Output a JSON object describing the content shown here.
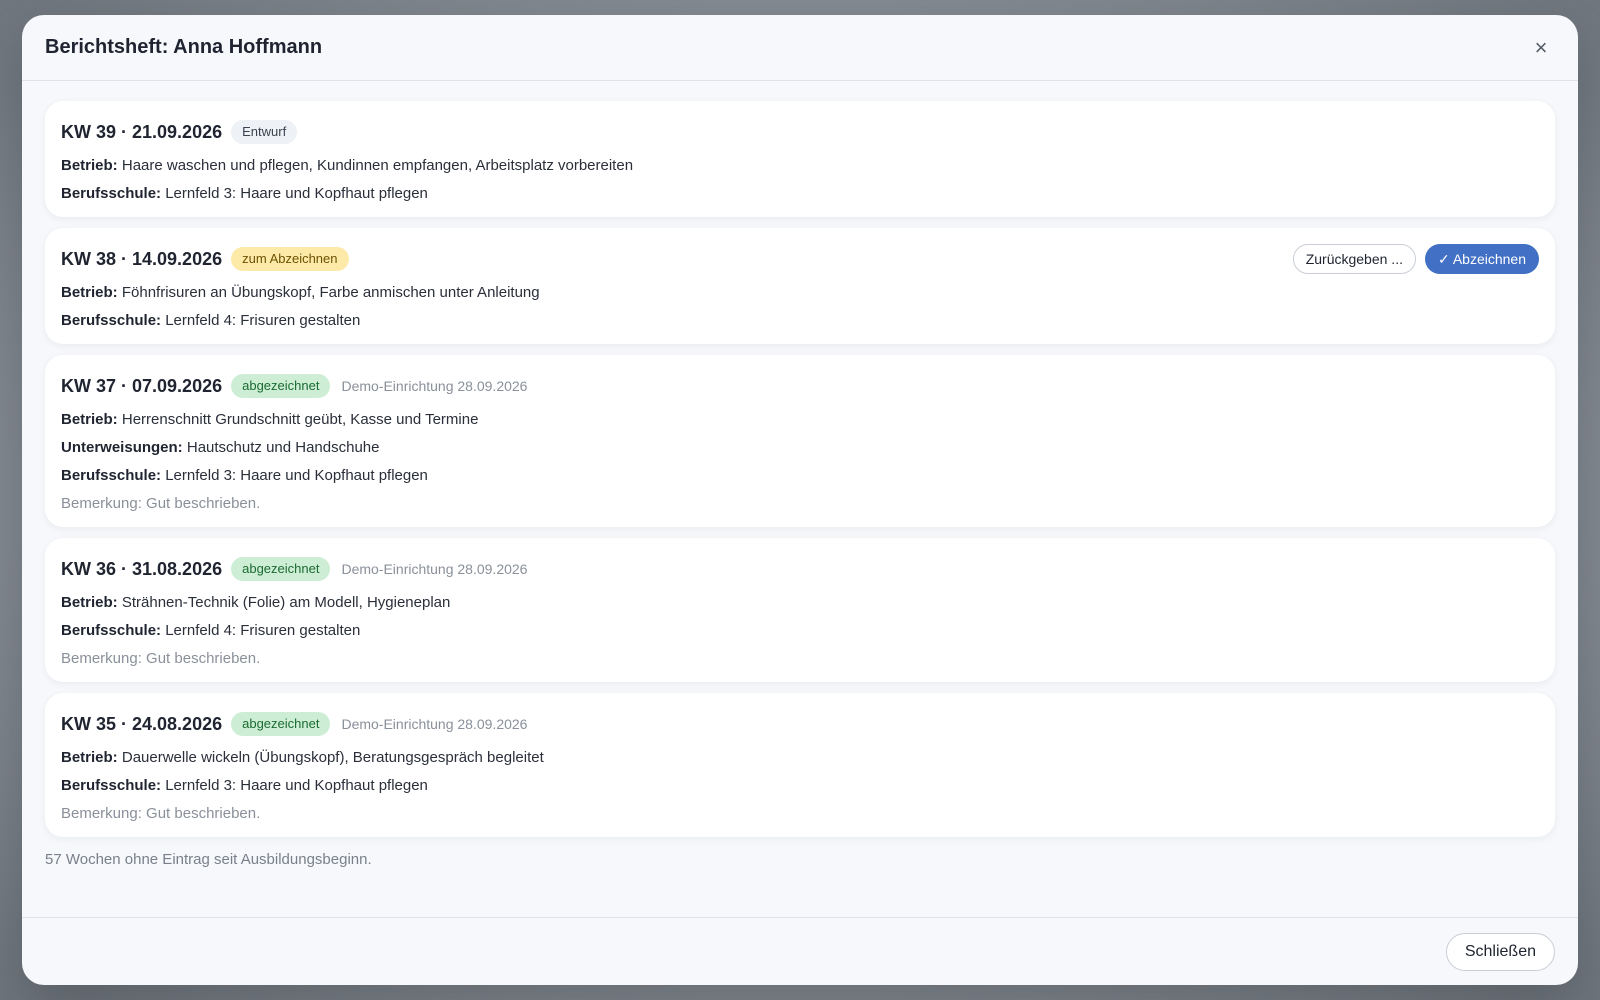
{
  "modal": {
    "title": "Berichtsheft: Anna Hoffmann",
    "close_icon": "×",
    "footer_note": "57 Wochen ohne Eintrag seit Ausbildungsbeginn.",
    "close_button": "Schließen"
  },
  "labels": {
    "betrieb": "Betrieb:",
    "berufsschule": "Berufsschule:",
    "unterweisungen": "Unterweisungen:"
  },
  "entries": [
    {
      "week": "KW 39 · 21.09.2026",
      "status": "Entwurf",
      "betrieb": "Haare waschen und pflegen, Kundinnen empfangen, Arbeitsplatz vorbereiten",
      "berufsschule": "Lernfeld 3: Haare und Kopfhaut pflegen"
    },
    {
      "week": "KW 38 · 14.09.2026",
      "status": "zum Abzeichnen",
      "betrieb": "Föhnfrisuren an Übungskopf, Farbe anmischen unter Anleitung",
      "berufsschule": "Lernfeld 4: Frisuren gestalten",
      "return_button": "Zurückgeben ...",
      "sign_button": "✓ Abzeichnen"
    },
    {
      "week": "KW 37 · 07.09.2026",
      "status": "abgezeichnet",
      "signed_by": "Demo-Einrichtung 28.09.2026",
      "betrieb": "Herrenschnitt Grundschnitt geübt, Kasse und Termine",
      "unterweisungen": "Hautschutz und Handschuhe",
      "berufsschule": "Lernfeld 3: Haare und Kopfhaut pflegen",
      "remark": "Bemerkung: Gut beschrieben."
    },
    {
      "week": "KW 36 · 31.08.2026",
      "status": "abgezeichnet",
      "signed_by": "Demo-Einrichtung 28.09.2026",
      "betrieb": "Strähnen-Technik (Folie) am Modell, Hygieneplan",
      "berufsschule": "Lernfeld 4: Frisuren gestalten",
      "remark": "Bemerkung: Gut beschrieben."
    },
    {
      "week": "KW 35 · 24.08.2026",
      "status": "abgezeichnet",
      "signed_by": "Demo-Einrichtung 28.09.2026",
      "betrieb": "Dauerwelle wickeln (Übungskopf), Beratungsgespräch begleitet",
      "berufsschule": "Lernfeld 3: Haare und Kopfhaut pflegen",
      "remark": "Bemerkung: Gut beschrieben."
    }
  ],
  "colors": {
    "primary": "#4170c4",
    "badge_draft": "#eef1f5",
    "badge_pending": "#fde9a8",
    "badge_signed": "#cdeed5"
  }
}
